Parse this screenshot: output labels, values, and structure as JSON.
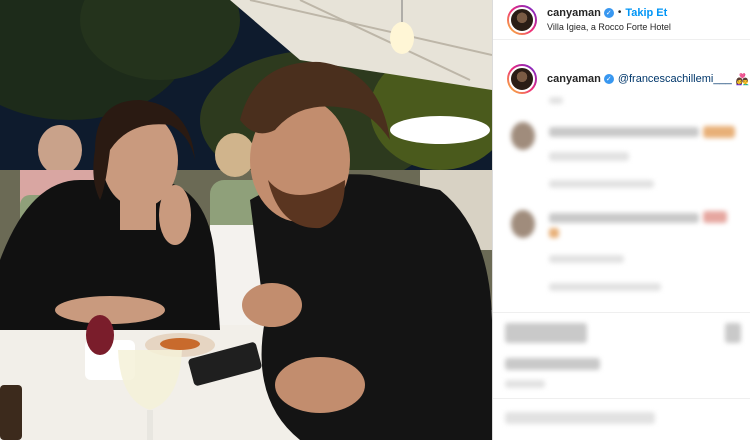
{
  "post": {
    "username": "canyaman",
    "follow_label": "Takip Et",
    "location": "Villa Igiea, a Rocco Forte Hotel"
  },
  "caption": {
    "username": "canyaman",
    "mention": "@francescachillemi___",
    "emoji": "👩‍❤️‍👨"
  },
  "icons": [
    "verified-badge-icon",
    "verified-badge-icon"
  ]
}
